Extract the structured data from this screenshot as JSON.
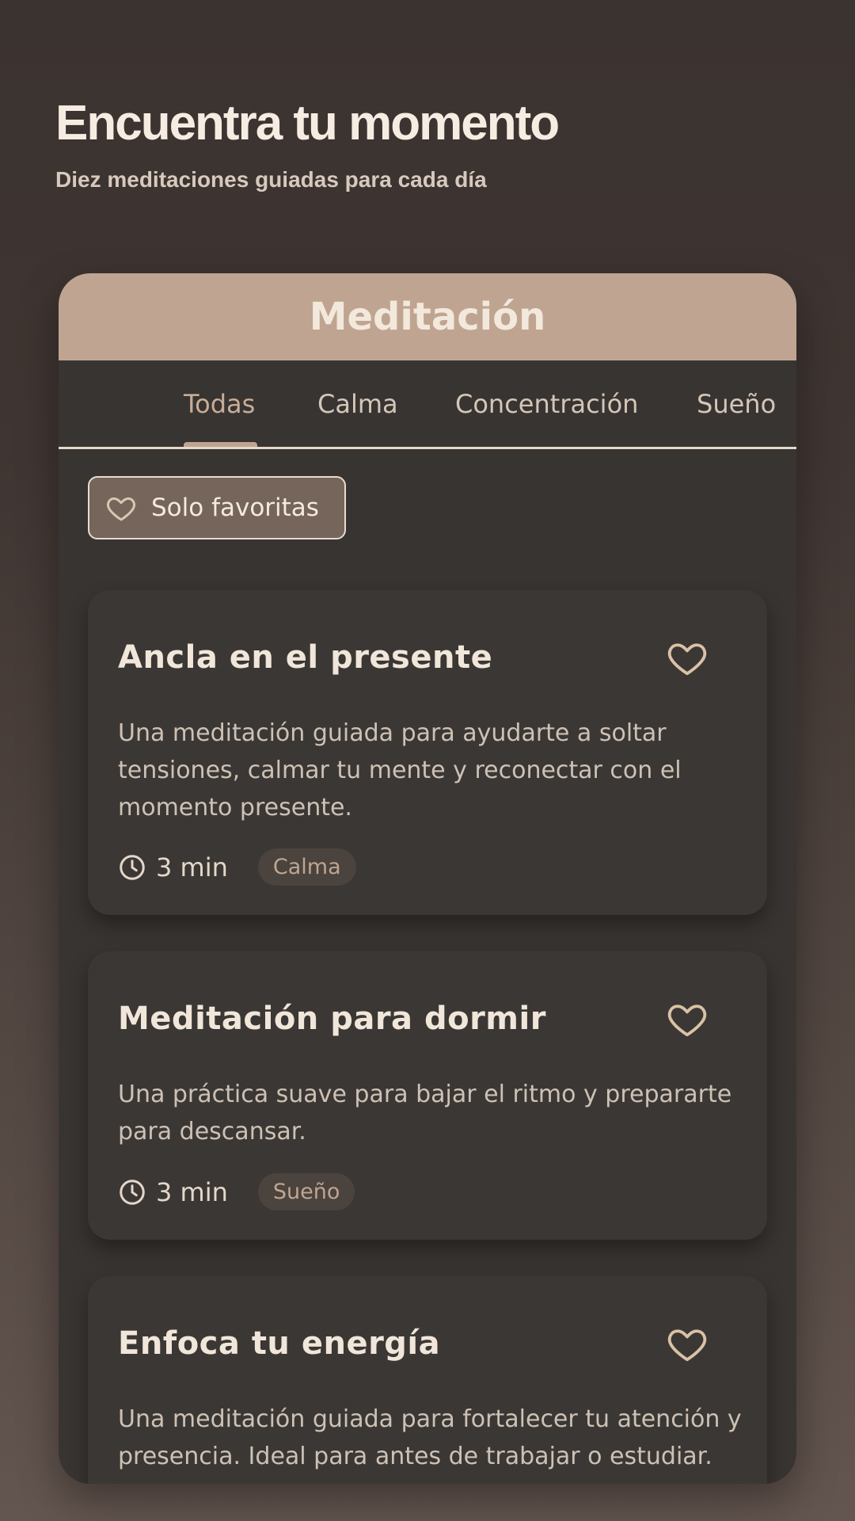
{
  "header": {
    "title": "Encuentra tu momento",
    "subtitle": "Diez meditaciones guiadas para cada día"
  },
  "panel": {
    "title": "Meditación",
    "tabs": [
      {
        "label": "Todas",
        "active": true
      },
      {
        "label": "Calma",
        "active": false
      },
      {
        "label": "Concentración",
        "active": false
      },
      {
        "label": "Sueño",
        "active": false
      }
    ],
    "filter": {
      "label": "Solo favoritas",
      "icon": "heart-outline-icon"
    }
  },
  "meditations": [
    {
      "title": "Ancla en el presente",
      "description": "Una meditación guiada para ayudarte a soltar tensiones, calmar tu mente y reconectar con el momento presente.",
      "duration": "3 min",
      "tag": "Calma"
    },
    {
      "title": "Meditación para dormir",
      "description": "Una práctica suave para bajar el ritmo y prepararte para descansar.",
      "duration": "3 min",
      "tag": "Sueño"
    },
    {
      "title": "Enfoca tu energía",
      "description": "Una meditación guiada para fortalecer tu atención y presencia. Ideal para antes de trabajar o estudiar."
    }
  ],
  "colors": {
    "accent": "#bfa591",
    "background": "#3b3330",
    "card": "#3b3734",
    "text": "#f1e6da"
  }
}
